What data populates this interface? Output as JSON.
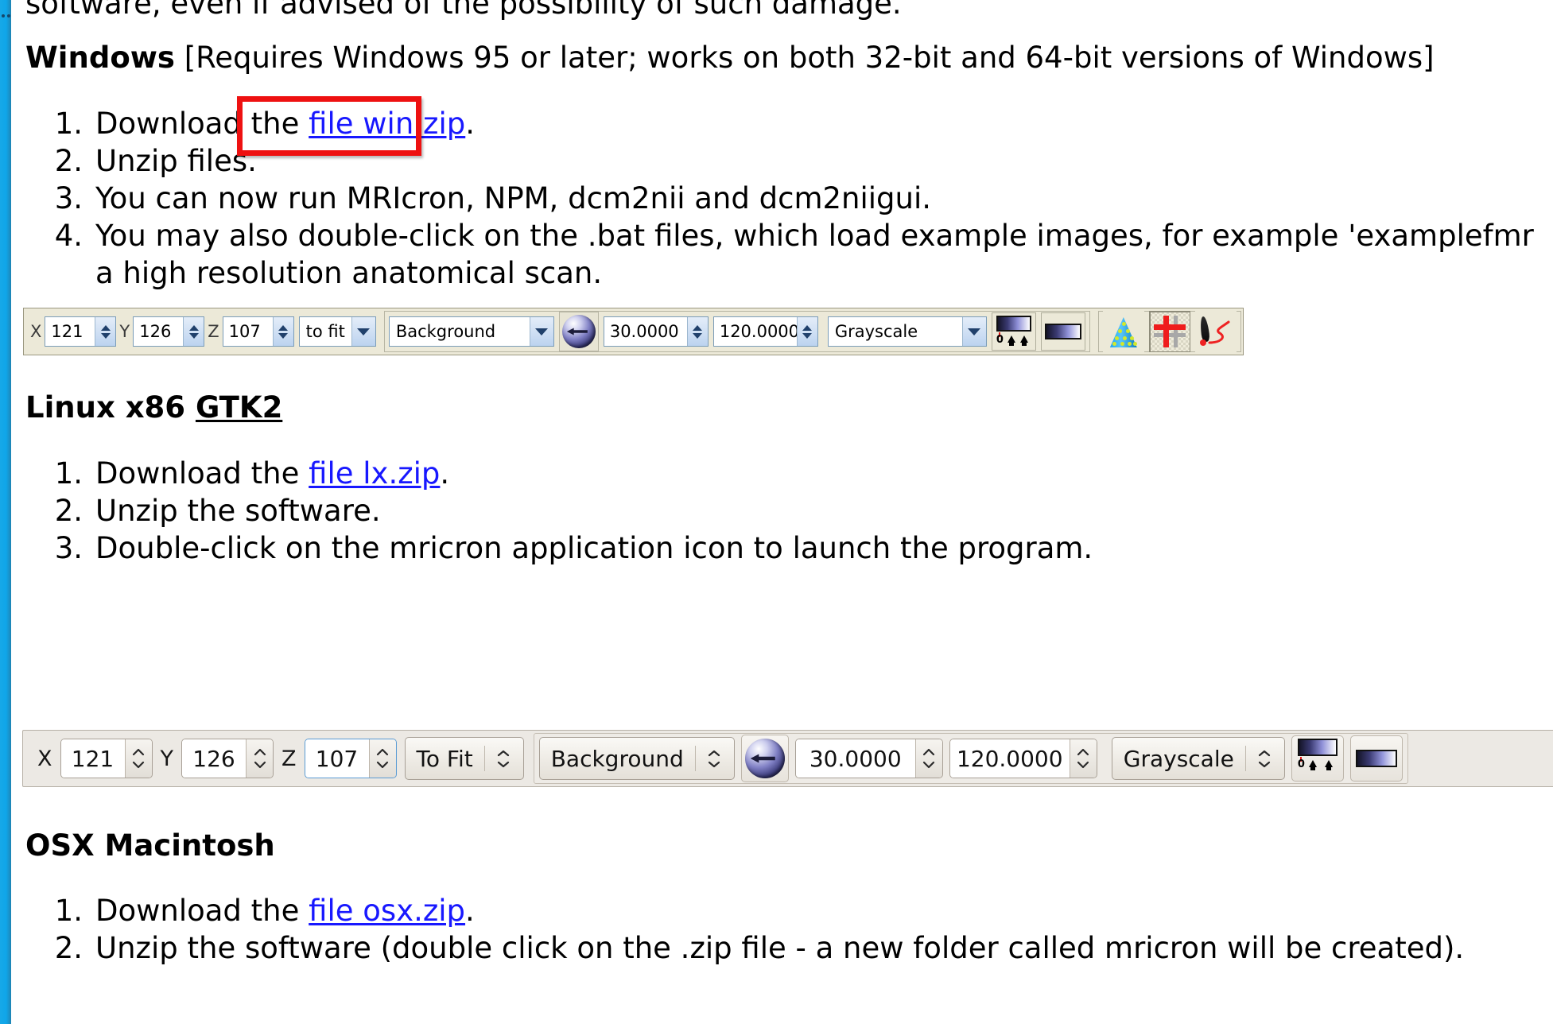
{
  "page": {
    "top_clipped_line": "software, even if advised of the possibility of such damage.",
    "sections": [
      {
        "heading_bold": "Windows",
        "heading_rest": " [Requires Windows 95 or later; works on both 32-bit and 64-bit versions of Windows]",
        "items": [
          {
            "num": "1.",
            "pre": "Download the ",
            "link": "file win.zip",
            "post": "."
          },
          {
            "num": "2.",
            "pre": "Unzip files.",
            "link": "",
            "post": ""
          },
          {
            "num": "3.",
            "pre": "You can now run MRIcron, NPM, dcm2nii and dcm2niigui.",
            "link": "",
            "post": ""
          },
          {
            "num": "4.",
            "pre": "You may also double-click on the .bat files, which load example images, for example 'examplefmr",
            "link": "",
            "post": ""
          },
          {
            "num": "",
            "pre": "a high resolution anatomical scan.",
            "link": "",
            "post": ""
          }
        ]
      },
      {
        "heading_bold": "Linux x86 ",
        "heading_link": "GTK2",
        "items": [
          {
            "num": "1.",
            "pre": "Download the ",
            "link": "file lx.zip",
            "post": "."
          },
          {
            "num": "2.",
            "pre": "Unzip the software.",
            "link": "",
            "post": ""
          },
          {
            "num": "3.",
            "pre": "Double-click on the mricron application icon to launch the program.",
            "link": "",
            "post": ""
          }
        ]
      },
      {
        "heading_bold": "OSX Macintosh",
        "items": [
          {
            "num": "1.",
            "pre": "Download the ",
            "link": "file osx.zip",
            "post": "."
          },
          {
            "num": "2.",
            "pre": "Unzip the software (double click on the .zip file - a new folder called mricron will be created).",
            "link": "",
            "post": ""
          }
        ]
      }
    ]
  },
  "annotation": {
    "color": "#ee1111",
    "target_label": "file win.zip"
  },
  "toolbar_windows": {
    "theme_label": "Windows classic toolbar",
    "x_label": "X",
    "x_value": "121",
    "y_label": "Y",
    "y_value": "126",
    "z_label": "Z",
    "z_value": "107",
    "zoom_combo": "to fit",
    "layer_combo": "Background",
    "back_button": "back-arrow-sphere-icon",
    "min_value": "30.0000",
    "max_value": "120.0000",
    "lut_combo": "Grayscale",
    "colorbar_widget": "colorbar-handles-icon",
    "colorbar_simple": "colorbar-icon",
    "tool_cone": "render-cone-icon",
    "tool_crosshair": "crosshair-icon",
    "tool_pen": "pen-draw-icon"
  },
  "toolbar_gtk": {
    "theme_label": "GTK2 toolbar",
    "x_label": "X",
    "x_value": "121",
    "y_label": "Y",
    "y_value": "126",
    "z_label": "Z",
    "z_value": "107",
    "zoom_combo": "To Fit",
    "layer_combo": "Background",
    "back_button": "back-arrow-sphere-icon",
    "min_value": "30.0000",
    "max_value": "120.0000",
    "lut_combo": "Grayscale",
    "colorbar_widget": "colorbar-handles-icon",
    "colorbar_simple": "colorbar-icon"
  },
  "colors": {
    "left_strip": "#0fa6e9",
    "link": "#1818ff",
    "annotation": "#ee1111",
    "win_toolbar_bg": "#ece9d8",
    "gtk_toolbar_bg": "#ece9e4",
    "crosshair_red": "#ef1c1c"
  }
}
